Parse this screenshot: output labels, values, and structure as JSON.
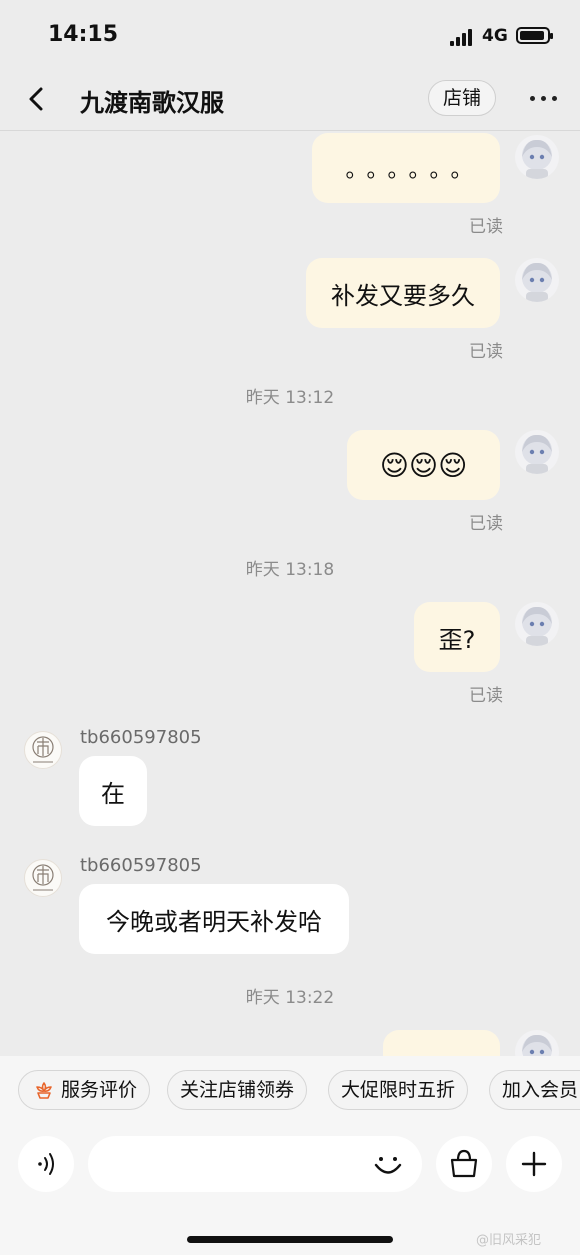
{
  "status": {
    "time": "14:15",
    "network": "4G"
  },
  "nav": {
    "title": "九渡南歌汉服",
    "store_button": "店铺"
  },
  "messages": {
    "m1": {
      "text": "。。。。。。",
      "status": "已读"
    },
    "m2": {
      "text": "补发又要多久",
      "status": "已读"
    },
    "ts1": "昨天 13:12",
    "m3": {
      "text": "😌😌😌",
      "status": "已读"
    },
    "ts2": "昨天 13:18",
    "m4": {
      "text": "歪?",
      "status": "已读"
    },
    "r1": {
      "sender": "tb660597805",
      "text": "在"
    },
    "r2": {
      "sender": "tb660597805",
      "text": "今晚或者明天补发哈"
    },
    "ts3": "昨天 13:22"
  },
  "quick_replies": [
    "服务评价",
    "关注店铺领券",
    "大促限时五折",
    "加入会员"
  ],
  "input": {
    "placeholder": ""
  },
  "watermark": "@旧风采犯",
  "icons": {
    "back": "chevron-left-icon",
    "more": "more-dots-icon",
    "service": "flower-icon",
    "voice": "voice-icon",
    "emoji": "smiley-icon",
    "shop": "shopping-bag-icon",
    "add": "plus-icon"
  },
  "colors": {
    "background": "#ececec",
    "outgoing_bubble": "#fdf6e3",
    "incoming_bubble": "#ffffff",
    "accent": "#e8652b"
  }
}
